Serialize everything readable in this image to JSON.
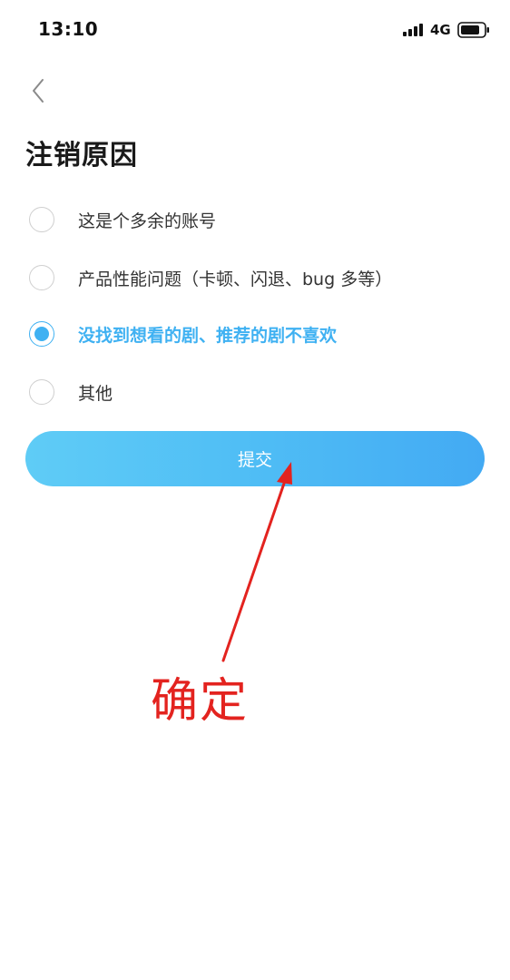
{
  "status_bar": {
    "time": "13:10",
    "network": "4G",
    "icons": [
      "signal-icon",
      "battery-icon"
    ]
  },
  "header": {
    "back_icon": "chevron-left-icon",
    "title": "注销原因"
  },
  "reasons": [
    {
      "label": "这是个多余的账号",
      "selected": false
    },
    {
      "label": "产品性能问题（卡顿、闪退、bug 多等）",
      "selected": false
    },
    {
      "label": "没找到想看的剧、推荐的剧不喜欢",
      "selected": true
    },
    {
      "label": "其他",
      "selected": false
    }
  ],
  "submit": {
    "label": "提交"
  },
  "annotation": {
    "text": "确定",
    "color": "#e3231f"
  },
  "colors": {
    "accent": "#3fb1f2",
    "button_start": "#5fccf6",
    "button_end": "#43aaf3",
    "annotation": "#e3231f"
  }
}
